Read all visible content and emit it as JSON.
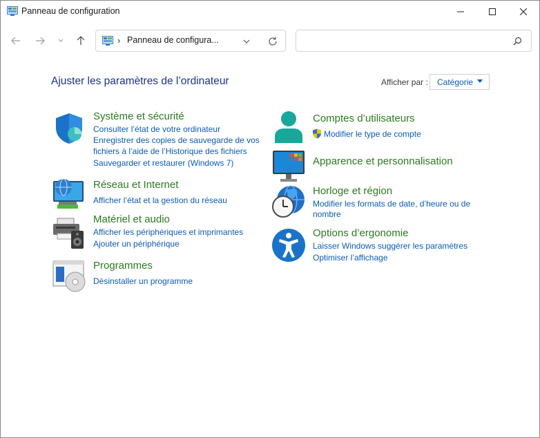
{
  "window": {
    "title": "Panneau de configuration"
  },
  "navigation": {
    "address_text": "Panneau de configura...",
    "address_separator": "›",
    "search_placeholder": ""
  },
  "header": {
    "title": "Ajuster les paramètres de l’ordinateur",
    "view_by_label": "Afficher par :",
    "view_by_value": "Catégorie"
  },
  "categories": {
    "system": {
      "title": "Système et sécurité",
      "links": [
        "Consulter l’état de votre ordinateur",
        "Enregistrer des copies de sauvegarde de vos",
        "fichiers à l’aide de l’Historique des fichiers",
        "Sauvegarder et restaurer (Windows 7)"
      ]
    },
    "network": {
      "title": "Réseau et Internet",
      "links": [
        "Afficher l’état et la gestion du réseau"
      ]
    },
    "hardware": {
      "title": "Matériel et audio",
      "links": [
        "Afficher les périphériques et imprimantes",
        "Ajouter un périphérique"
      ]
    },
    "programs": {
      "title": "Programmes",
      "links": [
        "Désinstaller un programme"
      ]
    },
    "accounts": {
      "title": "Comptes d’utilisateurs",
      "links": [
        "Modifier le type de compte"
      ]
    },
    "appearance": {
      "title": "Apparence et personnalisation",
      "links": []
    },
    "clock": {
      "title": "Horloge et région",
      "links": [
        "Modifier les formats de date, d’heure ou de",
        "nombre"
      ]
    },
    "ease": {
      "title": "Options d’ergonomie",
      "links": [
        "Laisser Windows suggérer les paramètres",
        "Optimiser l’affichage"
      ]
    }
  },
  "colors": {
    "accent_link": "#0a5bb5",
    "category_title": "#2b7a1f",
    "page_title": "#1e3287"
  }
}
